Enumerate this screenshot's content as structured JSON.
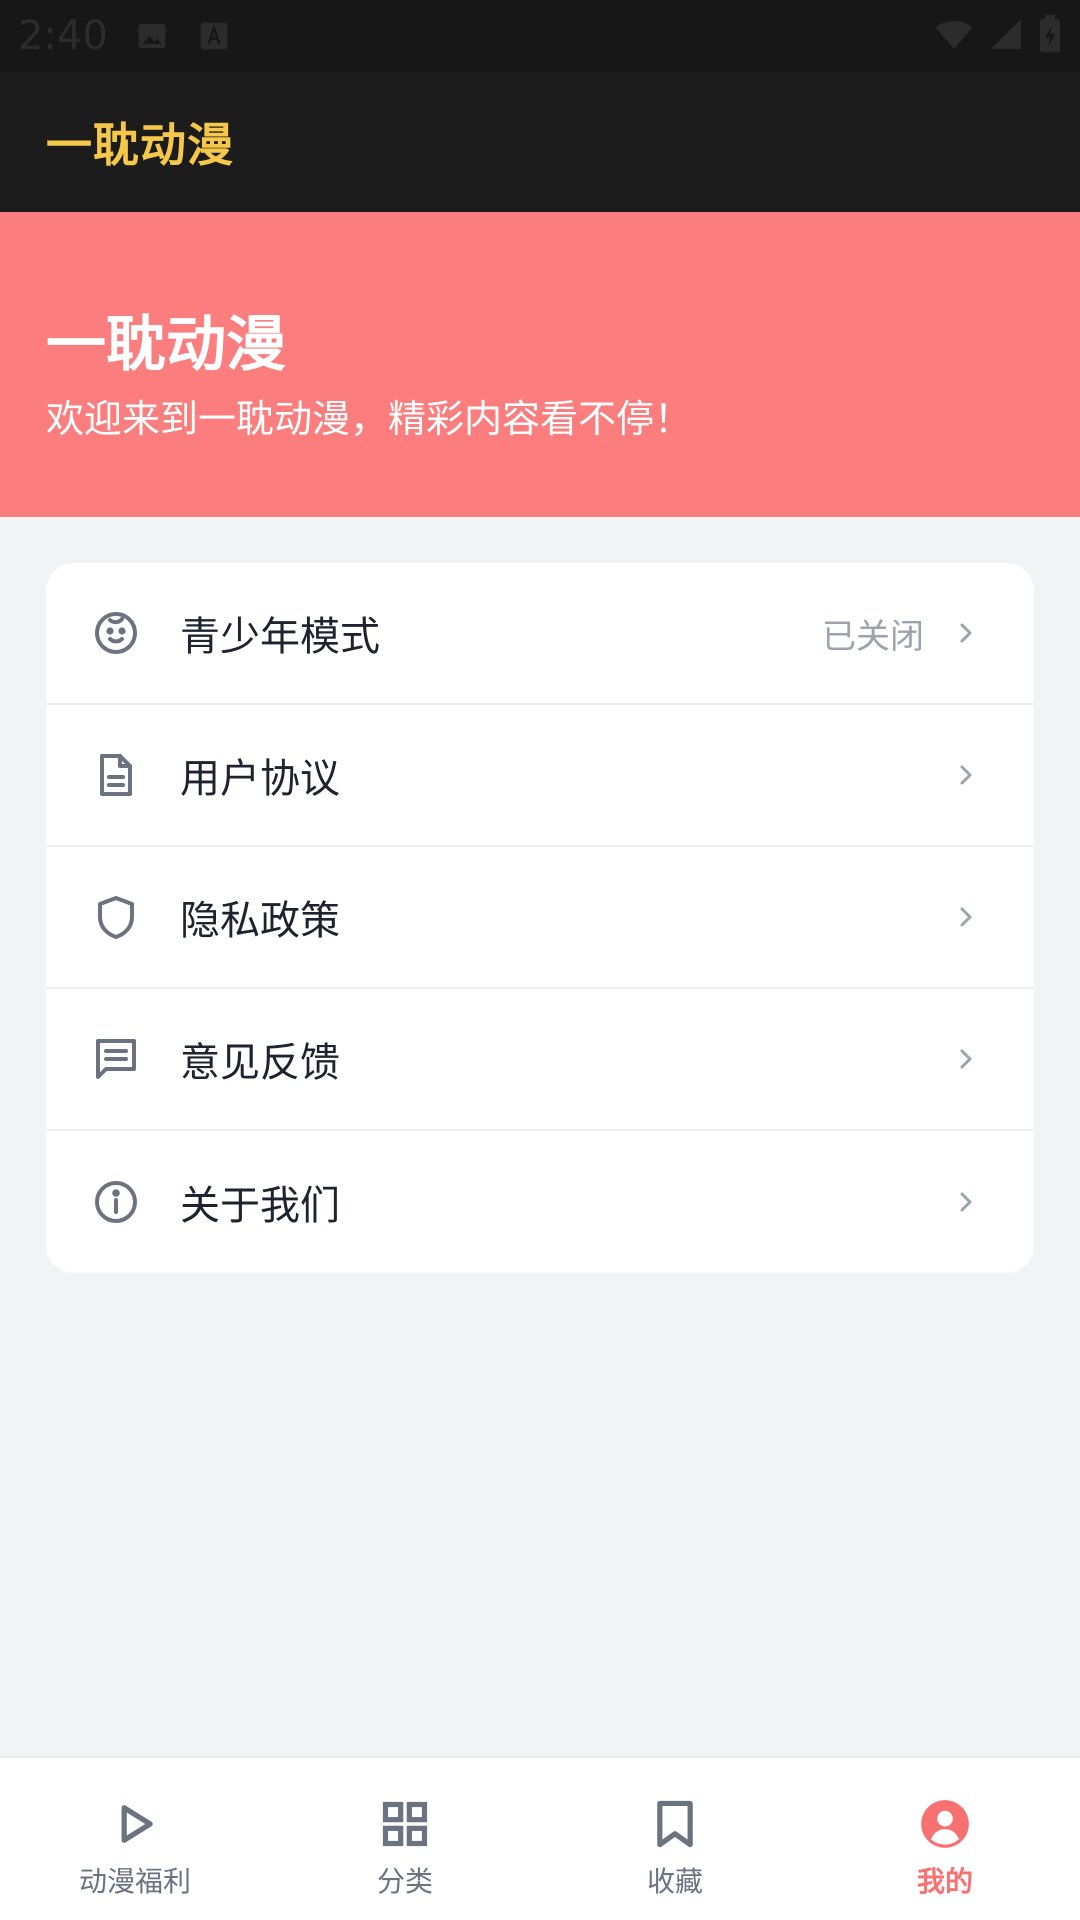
{
  "status_bar": {
    "time": "2:40"
  },
  "app_bar": {
    "title": "一耽动漫"
  },
  "hero": {
    "title": "一耽动漫",
    "subtitle": "欢迎来到一耽动漫，精彩内容看不停！"
  },
  "menu": [
    {
      "icon": "baby-face-icon",
      "label": "青少年模式",
      "status": "已关闭"
    },
    {
      "icon": "document-icon",
      "label": "用户协议"
    },
    {
      "icon": "shield-icon",
      "label": "隐私政策"
    },
    {
      "icon": "message-icon",
      "label": "意见反馈"
    },
    {
      "icon": "info-icon",
      "label": "关于我们"
    }
  ],
  "tabs": [
    {
      "icon": "play-icon",
      "label": "动漫福利",
      "active": false
    },
    {
      "icon": "grid-icon",
      "label": "分类",
      "active": false
    },
    {
      "icon": "bookmark-icon",
      "label": "收藏",
      "active": false
    },
    {
      "icon": "user-circle-icon",
      "label": "我的",
      "active": true
    }
  ],
  "colors": {
    "app_bar_bg": "#1c1c1c",
    "title_accent": "#f5c84a",
    "hero_bg": "#fc7d7d",
    "active_tab": "#f87171",
    "icon_gray": "#6b7280"
  }
}
